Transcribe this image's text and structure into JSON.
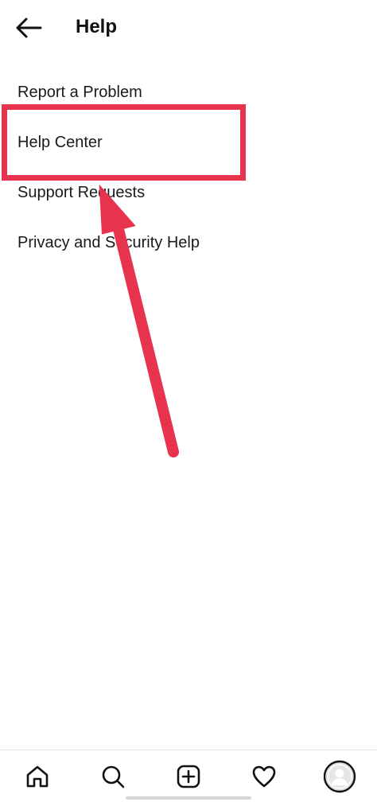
{
  "header": {
    "title": "Help",
    "back_icon": "arrow-left-icon"
  },
  "menu": {
    "items": [
      {
        "label": "Report a Problem"
      },
      {
        "label": "Help Center"
      },
      {
        "label": "Support Requests"
      },
      {
        "label": "Privacy and Security Help"
      }
    ]
  },
  "annotation": {
    "color": "#e8334f",
    "highlighted_item": "Help Center"
  },
  "bottom_nav": {
    "items": [
      {
        "icon": "home-icon"
      },
      {
        "icon": "search-icon"
      },
      {
        "icon": "add-post-icon"
      },
      {
        "icon": "heart-icon"
      },
      {
        "icon": "profile-avatar-icon"
      }
    ]
  }
}
